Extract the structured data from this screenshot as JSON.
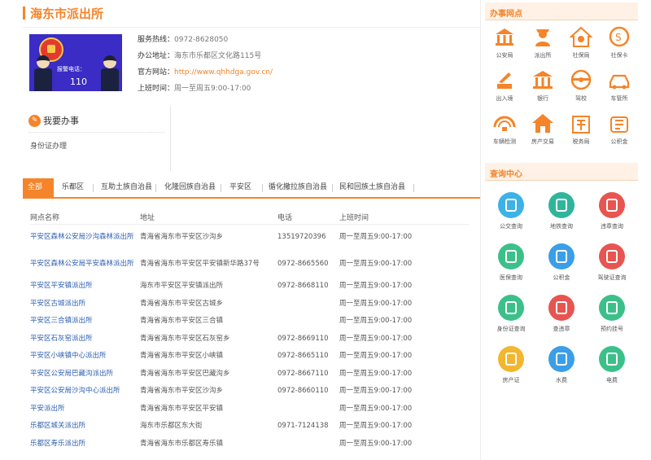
{
  "station": {
    "title": "海东市派出所",
    "emblem": {
      "hotline_label": "报警电话：",
      "hotline_number": "110"
    },
    "info": [
      {
        "label": "服务热线：",
        "value": "0972-8628050"
      },
      {
        "label": "办公地址：",
        "value": "海东市乐都区文化路115号"
      },
      {
        "label": "官方网站：",
        "value": "http://www.qhhdga.gov.cn/"
      },
      {
        "label": "上班时间：",
        "value": "周一至周五9:00-17:00"
      }
    ]
  },
  "apply": {
    "title": "我要办事",
    "icon": "edit-icon",
    "items": [
      "身份证办理"
    ]
  },
  "tabs": [
    "全部",
    "乐都区",
    "互助土族自治县",
    "化隆回族自治县",
    "平安区",
    "循化撒拉族自治县",
    "民和回族土族自治县"
  ],
  "table": {
    "headers": [
      "网点名称",
      "地址",
      "电话",
      "上班时间"
    ],
    "rows": [
      [
        "平安区森林公安局沙沟森林派出所",
        "青海省海东市平安区沙沟乡",
        "13519720396",
        "周一至周五9:00-17:00"
      ],
      [
        "平安区森林公安局平安森林派出所",
        "青海省海东市平安区平安镇新华路37号",
        "0972-8665560",
        "周一至周五9:00-17:00"
      ],
      [
        "平安区平安镇派出所",
        "海东市平安区平安镇派出所",
        "0972-8668110",
        "周一至周五9:00-17:00"
      ],
      [
        "平安区古城派出所",
        "青海省海东市平安区古城乡",
        "",
        "周一至周五9:00-17:00"
      ],
      [
        "平安区三合镇派出所",
        "青海省海东市平安区三合镇",
        "",
        "周一至周五9:00-17:00"
      ],
      [
        "平安区石灰窑派出所",
        "青海省海东市平安区石灰窑乡",
        "0972-8669110",
        "周一至周五9:00-17:00"
      ],
      [
        "平安区小峡镇中心派出所",
        "青海省海东市平安区小峡镇",
        "0972-8665110",
        "周一至周五9:00-17:00"
      ],
      [
        "平安区公安局巴藏沟派出所",
        "青海省海东市平安区巴藏沟乡",
        "0972-8667110",
        "周一至周五9:00-17:00"
      ],
      [
        "平安区公安局沙沟中心派出所",
        "青海省海东市平安区沙沟乡",
        "0972-8660110",
        "周一至周五9:00-17:00"
      ],
      [
        "平安派出所",
        "青海省海东市平安区平安镇",
        "",
        "周一至周五9:00-17:00"
      ],
      [
        "乐都区城关派出所",
        "海东市乐都区东大街",
        "0971-7124138",
        "周一至周五9:00-17:00"
      ],
      [
        "乐都区寿乐派出所",
        "青海省海东市乐都区寿乐镇",
        "",
        "周一至周五9:00-17:00"
      ]
    ]
  },
  "sidebar": {
    "offices_title": "办事网点",
    "offices": [
      {
        "label": "公安局",
        "icon": "government-building-icon"
      },
      {
        "label": "派出所",
        "icon": "police-officer-icon"
      },
      {
        "label": "社保局",
        "icon": "social-security-icon"
      },
      {
        "label": "社保卡",
        "icon": "card-logo-icon"
      },
      {
        "label": "出入境",
        "icon": "exit-entry-icon"
      },
      {
        "label": "银行",
        "icon": "bank-icon"
      },
      {
        "label": "驾校",
        "icon": "steering-wheel-icon"
      },
      {
        "label": "车管所",
        "icon": "car-icon"
      },
      {
        "label": "车辆检测",
        "icon": "vehicle-inspection-icon"
      },
      {
        "label": "房产交易",
        "icon": "house-icon"
      },
      {
        "label": "税务局",
        "icon": "tax-icon"
      },
      {
        "label": "公积金",
        "icon": "housing-fund-icon"
      }
    ],
    "query_title": "查询中心",
    "queries": [
      {
        "label": "公交查询",
        "icon": "bus-icon",
        "color": "#3cb2e6"
      },
      {
        "label": "地铁查询",
        "icon": "subway-icon",
        "color": "#2fb59c"
      },
      {
        "label": "违章查询",
        "icon": "walking-person-icon",
        "color": "#e85450"
      },
      {
        "label": "医保查询",
        "icon": "shield-icon",
        "color": "#3cc08a"
      },
      {
        "label": "公积金",
        "icon": "chart-icon",
        "color": "#3a9ee8"
      },
      {
        "label": "驾驶证查询",
        "icon": "car-icon",
        "color": "#e85450"
      },
      {
        "label": "身份证查询",
        "icon": "id-card-icon",
        "color": "#3cc08a"
      },
      {
        "label": "查违章",
        "icon": "ticket-icon",
        "color": "#e85450"
      },
      {
        "label": "预约挂号",
        "icon": "medical-cross-icon",
        "color": "#3cc08a"
      },
      {
        "label": "房产证",
        "icon": "buildings-icon",
        "color": "#f2b630"
      },
      {
        "label": "水费",
        "icon": "water-drop-icon",
        "color": "#3a9ee8"
      },
      {
        "label": "电费",
        "icon": "electricity-icon",
        "color": "#3cc08a"
      }
    ]
  },
  "colors": {
    "accent": "#f5842a",
    "link": "#2a5db0",
    "emblem_bg": "#3a2cc4"
  }
}
